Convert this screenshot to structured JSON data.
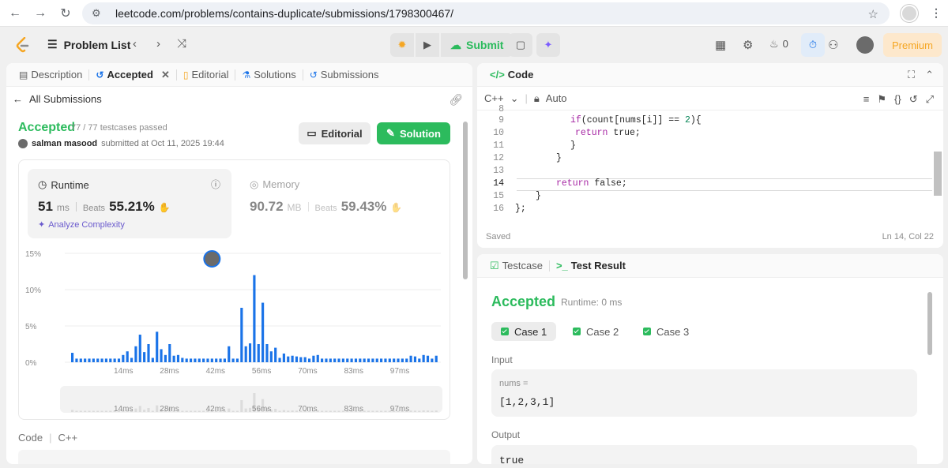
{
  "browser": {
    "url": "leetcode.com/problems/contains-duplicate/submissions/1798300467/"
  },
  "nav": {
    "problem_list": "Problem List",
    "submit": "Submit",
    "fire_count": "0",
    "premium": "Premium"
  },
  "left_tabs": [
    {
      "label": "Description",
      "icon": "description-icon"
    },
    {
      "label": "Accepted",
      "icon": "history-icon"
    },
    {
      "label": "Editorial",
      "icon": "book-icon"
    },
    {
      "label": "Solutions",
      "icon": "flask-icon"
    },
    {
      "label": "Submissions",
      "icon": "history-icon"
    }
  ],
  "submission": {
    "all_submissions": "All Submissions",
    "status": "Accepted",
    "testcases": "77 / 77 testcases passed",
    "user": "salman masood",
    "submitted_at": "submitted at Oct 11, 2025 19:44",
    "editorial_btn": "Editorial",
    "solution_btn": "Solution"
  },
  "runtime": {
    "label": "Runtime",
    "value": "51",
    "unit": "ms",
    "beats_label": "Beats",
    "beats": "55.21%",
    "analyze": "Analyze Complexity"
  },
  "memory": {
    "label": "Memory",
    "value": "90.72",
    "unit": "MB",
    "beats_label": "Beats",
    "beats": "59.43%"
  },
  "chart_data": {
    "type": "bar",
    "y_ticks": [
      "15%",
      "10%",
      "5%",
      "0%"
    ],
    "ylim": [
      0,
      15
    ],
    "x_ticks": [
      "14ms",
      "28ms",
      "42ms",
      "56ms",
      "70ms",
      "83ms",
      "97ms"
    ],
    "highlight_index": 33,
    "values": [
      1.3,
      0.5,
      0.5,
      0.5,
      0.5,
      0.5,
      0.5,
      0.5,
      0.5,
      0.5,
      0.5,
      0.5,
      1.0,
      1.5,
      0.6,
      2.2,
      3.8,
      1.4,
      2.5,
      0.6,
      4.2,
      1.8,
      1.0,
      2.5,
      0.9,
      1.0,
      0.6,
      0.5,
      0.5,
      0.5,
      0.5,
      0.5,
      0.5,
      0.5,
      0.5,
      0.5,
      0.5,
      2.2,
      0.5,
      0.5,
      7.5,
      2.2,
      2.6,
      12.0,
      2.5,
      8.2,
      2.5,
      1.5,
      2.0,
      0.6,
      1.2,
      0.8,
      0.9,
      0.8,
      0.7,
      0.7,
      0.5,
      0.9,
      1.0,
      0.5,
      0.5,
      0.5,
      0.5,
      0.5,
      0.5,
      0.5,
      0.5,
      0.5,
      0.5,
      0.5,
      0.5,
      0.5,
      0.5,
      0.5,
      0.5,
      0.5,
      0.5,
      0.5,
      0.5,
      0.5,
      0.9,
      0.8,
      0.5,
      1.0,
      0.9,
      0.5,
      0.9
    ]
  },
  "code_section": {
    "label": "Code",
    "lang": "C++"
  },
  "code_panel": {
    "title": "Code",
    "lang": "C++",
    "mode": "Auto",
    "saved": "Saved",
    "position": "Ln 14, Col 22",
    "lines": [
      {
        "n": "8",
        "text": ""
      },
      {
        "n": "9",
        "text": "if(count[nums[i]] == 2){"
      },
      {
        "n": "10",
        "text": "return true;"
      },
      {
        "n": "11",
        "text": "}"
      },
      {
        "n": "12",
        "text": "}"
      },
      {
        "n": "13",
        "text": ""
      },
      {
        "n": "14",
        "text": "return false;"
      },
      {
        "n": "15",
        "text": "}"
      },
      {
        "n": "16",
        "text": "};"
      }
    ]
  },
  "test_panel": {
    "tab_testcase": "Testcase",
    "tab_result": "Test Result",
    "status": "Accepted",
    "runtime": "Runtime: 0 ms",
    "cases": [
      "Case 1",
      "Case 2",
      "Case 3"
    ],
    "input_label": "Input",
    "input_name": "nums =",
    "input_value": "[1,2,3,1]",
    "output_label": "Output",
    "output_value": "true"
  }
}
